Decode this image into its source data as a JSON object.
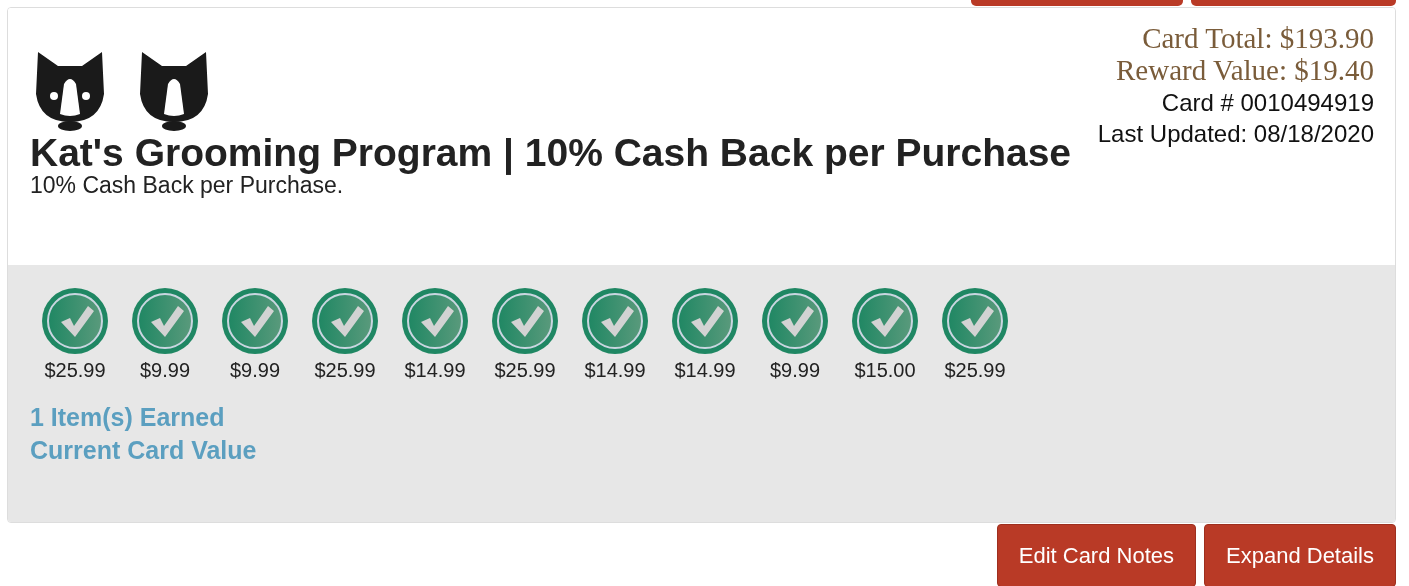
{
  "card": {
    "total": "Card Total: $193.90",
    "reward": "Reward Value: $19.40",
    "number": "Card # 0010494919",
    "updated": "Last Updated: 08/18/2020",
    "title": "Kat's Grooming Program | 10% Cash Back per Purchase",
    "subtitle": "10% Cash Back per Purchase."
  },
  "stamps": [
    {
      "amount": "$25.99",
      "stamped": true
    },
    {
      "amount": "$9.99",
      "stamped": true
    },
    {
      "amount": "$9.99",
      "stamped": true
    },
    {
      "amount": "$25.99",
      "stamped": true
    },
    {
      "amount": "$14.99",
      "stamped": true
    },
    {
      "amount": "$25.99",
      "stamped": true
    },
    {
      "amount": "$14.99",
      "stamped": true
    },
    {
      "amount": "$14.99",
      "stamped": true
    },
    {
      "amount": "$9.99",
      "stamped": true
    },
    {
      "amount": "$15.00",
      "stamped": true
    },
    {
      "amount": "$25.99",
      "stamped": true
    }
  ],
  "links": [
    "1 Item(s) Earned",
    "Current Card Value"
  ],
  "buttons": [
    "Edit Card Notes",
    "Expand Details"
  ]
}
